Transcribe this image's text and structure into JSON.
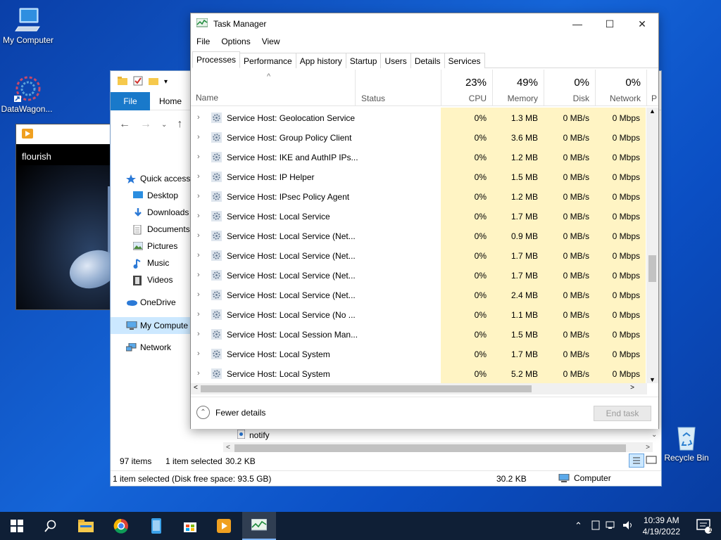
{
  "desktop": {
    "icons": [
      {
        "label": "My Computer",
        "icon": "computer-icon"
      },
      {
        "label": "DataWagon...",
        "icon": "app-icon"
      },
      {
        "label": "Recycle Bin",
        "icon": "recycle-bin-icon"
      }
    ]
  },
  "media_player": {
    "title": "flourish"
  },
  "explorer": {
    "ribbon_tabs": [
      "File",
      "Home"
    ],
    "sidebar": [
      {
        "label": "Quick access",
        "icon": "star-icon"
      },
      {
        "label": "Desktop",
        "icon": "desktop-icon"
      },
      {
        "label": "Downloads",
        "icon": "downloads-icon"
      },
      {
        "label": "Documents",
        "icon": "documents-icon"
      },
      {
        "label": "Pictures",
        "icon": "pictures-icon"
      },
      {
        "label": "Music",
        "icon": "music-icon"
      },
      {
        "label": "Videos",
        "icon": "videos-icon"
      },
      {
        "label": "OneDrive",
        "icon": "cloud-icon"
      },
      {
        "label": "My Compute",
        "icon": "computer-icon"
      },
      {
        "label": "Network",
        "icon": "network-icon"
      }
    ],
    "visible_file": "notify",
    "item_count": "97 items",
    "selection": "1 item selected",
    "selection_size": "30.2 KB",
    "details_bar": "1 item selected (Disk free space: 93.5 GB)",
    "details_size": "30.2 KB",
    "details_location": "Computer"
  },
  "task_manager": {
    "title": "Task Manager",
    "menu": [
      "File",
      "Options",
      "View"
    ],
    "tabs": [
      "Processes",
      "Performance",
      "App history",
      "Startup",
      "Users",
      "Details",
      "Services"
    ],
    "active_tab": "Processes",
    "columns": {
      "name": "Name",
      "status": "Status",
      "cpu": {
        "pct": "23%",
        "label": "CPU"
      },
      "memory": {
        "pct": "49%",
        "label": "Memory"
      },
      "disk": {
        "pct": "0%",
        "label": "Disk"
      },
      "network": {
        "pct": "0%",
        "label": "Network"
      },
      "power": "P"
    },
    "rows": [
      {
        "name": "Service Host: Geolocation Service",
        "cpu": "0%",
        "memory": "1.3 MB",
        "disk": "0 MB/s",
        "network": "0 Mbps"
      },
      {
        "name": "Service Host: Group Policy Client",
        "cpu": "0%",
        "memory": "3.6 MB",
        "disk": "0 MB/s",
        "network": "0 Mbps"
      },
      {
        "name": "Service Host: IKE and AuthIP IPs...",
        "cpu": "0%",
        "memory": "1.2 MB",
        "disk": "0 MB/s",
        "network": "0 Mbps"
      },
      {
        "name": "Service Host: IP Helper",
        "cpu": "0%",
        "memory": "1.5 MB",
        "disk": "0 MB/s",
        "network": "0 Mbps"
      },
      {
        "name": "Service Host: IPsec Policy Agent",
        "cpu": "0%",
        "memory": "1.2 MB",
        "disk": "0 MB/s",
        "network": "0 Mbps"
      },
      {
        "name": "Service Host: Local Service",
        "cpu": "0%",
        "memory": "1.7 MB",
        "disk": "0 MB/s",
        "network": "0 Mbps"
      },
      {
        "name": "Service Host: Local Service (Net...",
        "cpu": "0%",
        "memory": "0.9 MB",
        "disk": "0 MB/s",
        "network": "0 Mbps"
      },
      {
        "name": "Service Host: Local Service (Net...",
        "cpu": "0%",
        "memory": "1.7 MB",
        "disk": "0 MB/s",
        "network": "0 Mbps"
      },
      {
        "name": "Service Host: Local Service (Net...",
        "cpu": "0%",
        "memory": "1.7 MB",
        "disk": "0 MB/s",
        "network": "0 Mbps"
      },
      {
        "name": "Service Host: Local Service (Net...",
        "cpu": "0%",
        "memory": "2.4 MB",
        "disk": "0 MB/s",
        "network": "0 Mbps"
      },
      {
        "name": "Service Host: Local Service (No ...",
        "cpu": "0%",
        "memory": "1.1 MB",
        "disk": "0 MB/s",
        "network": "0 Mbps"
      },
      {
        "name": "Service Host: Local Session Man...",
        "cpu": "0%",
        "memory": "1.5 MB",
        "disk": "0 MB/s",
        "network": "0 Mbps"
      },
      {
        "name": "Service Host: Local System",
        "cpu": "0%",
        "memory": "1.7 MB",
        "disk": "0 MB/s",
        "network": "0 Mbps"
      },
      {
        "name": "Service Host: Local System",
        "cpu": "0%",
        "memory": "5.2 MB",
        "disk": "0 MB/s",
        "network": "0 Mbps"
      }
    ],
    "fewer_details": "Fewer details",
    "end_task": "End task",
    "band_color": "#fff4c4"
  },
  "taskbar": {
    "apps": [
      "start-icon",
      "search-icon",
      "file-explorer-icon",
      "chrome-icon",
      "phone-app-icon",
      "store-icon",
      "media-player-icon",
      "task-manager-icon"
    ],
    "time": "10:39 AM",
    "date": "4/19/2022",
    "notification_count": "1"
  }
}
